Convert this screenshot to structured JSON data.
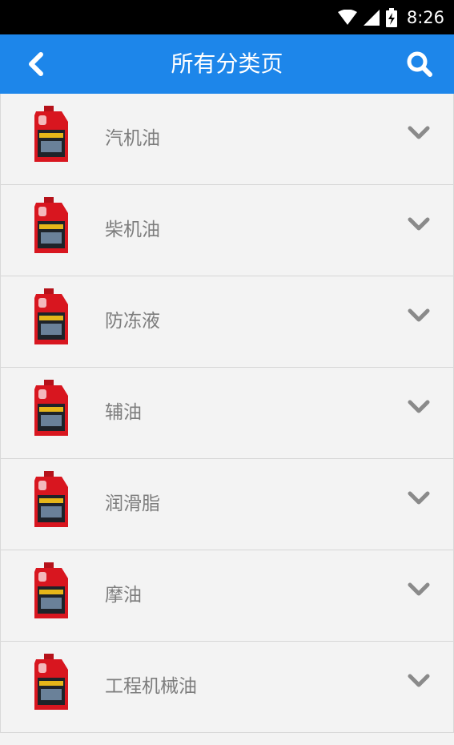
{
  "status_bar": {
    "time": "8:26",
    "icons": [
      "wifi-icon",
      "cell-signal-icon",
      "battery-charging-icon"
    ]
  },
  "app_bar": {
    "title": "所有分类页",
    "back_icon": "chevron-left-icon",
    "search_icon": "search-icon",
    "color": "#1d86ea"
  },
  "categories": [
    {
      "label": "汽机油"
    },
    {
      "label": "柴机油"
    },
    {
      "label": "防冻液"
    },
    {
      "label": "辅油"
    },
    {
      "label": "润滑脂"
    },
    {
      "label": "摩油"
    },
    {
      "label": "工程机械油"
    }
  ],
  "colors": {
    "text": "#7d7d7d",
    "chevron": "#8a8a8a",
    "background": "#f3f3f3",
    "divider": "#d6d6d6",
    "product_red": "#d8161f"
  }
}
